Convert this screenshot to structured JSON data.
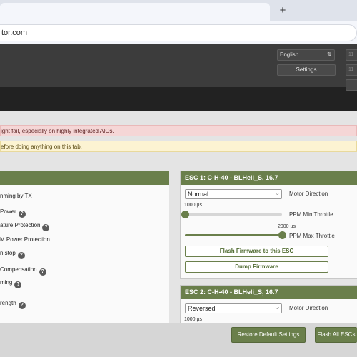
{
  "browser": {
    "new_tab_label": "+",
    "url": "tor.com"
  },
  "header": {
    "language": "English",
    "settings_label": "Settings",
    "stub_label": "11"
  },
  "notices": {
    "warning_red": "ight fail, especially on highly integrated AIOs.",
    "warning_yellow": "efore doing anything on this tab."
  },
  "left_options": [
    {
      "label": "nming by TX",
      "help": false
    },
    {
      "label": "Power",
      "help": true
    },
    {
      "label": "ature Protection",
      "help": true
    },
    {
      "label": "M Power Protection",
      "help": false
    },
    {
      "label": "n stop",
      "help": true
    },
    {
      "label": "Compensation",
      "help": true
    },
    {
      "label": "ming",
      "help": true
    },
    {
      "label": "rength",
      "help": true
    }
  ],
  "esc1": {
    "title": "ESC 1: C-H-40 - BLHeli_S, 16.7",
    "direction_value": "Normal",
    "direction_label": "Motor Direction",
    "min_value": "1000 µs",
    "min_label": "PPM Min Throttle",
    "min_fraction": 0.0,
    "max_value": "2000 µs",
    "max_label": "PPM Max Throttle",
    "max_fraction": 1.0,
    "flash_label": "Flash Firmware to this ESC",
    "dump_label": "Dump Firmware"
  },
  "esc2": {
    "title": "ESC 2: C-H-40 - BLHeli_S, 16.7",
    "direction_value": "Reversed",
    "direction_label": "Motor Direction",
    "min_value": "1000 µs"
  },
  "footer": {
    "restore_label": "Restore Default Settings",
    "flash_all_label": "Flash All ESCs"
  },
  "colors": {
    "accent": "#6a7f4b",
    "header": "#3c3c3c",
    "warning_red_bg": "#f5d6d6",
    "warning_yellow_bg": "#fcf3d2"
  }
}
